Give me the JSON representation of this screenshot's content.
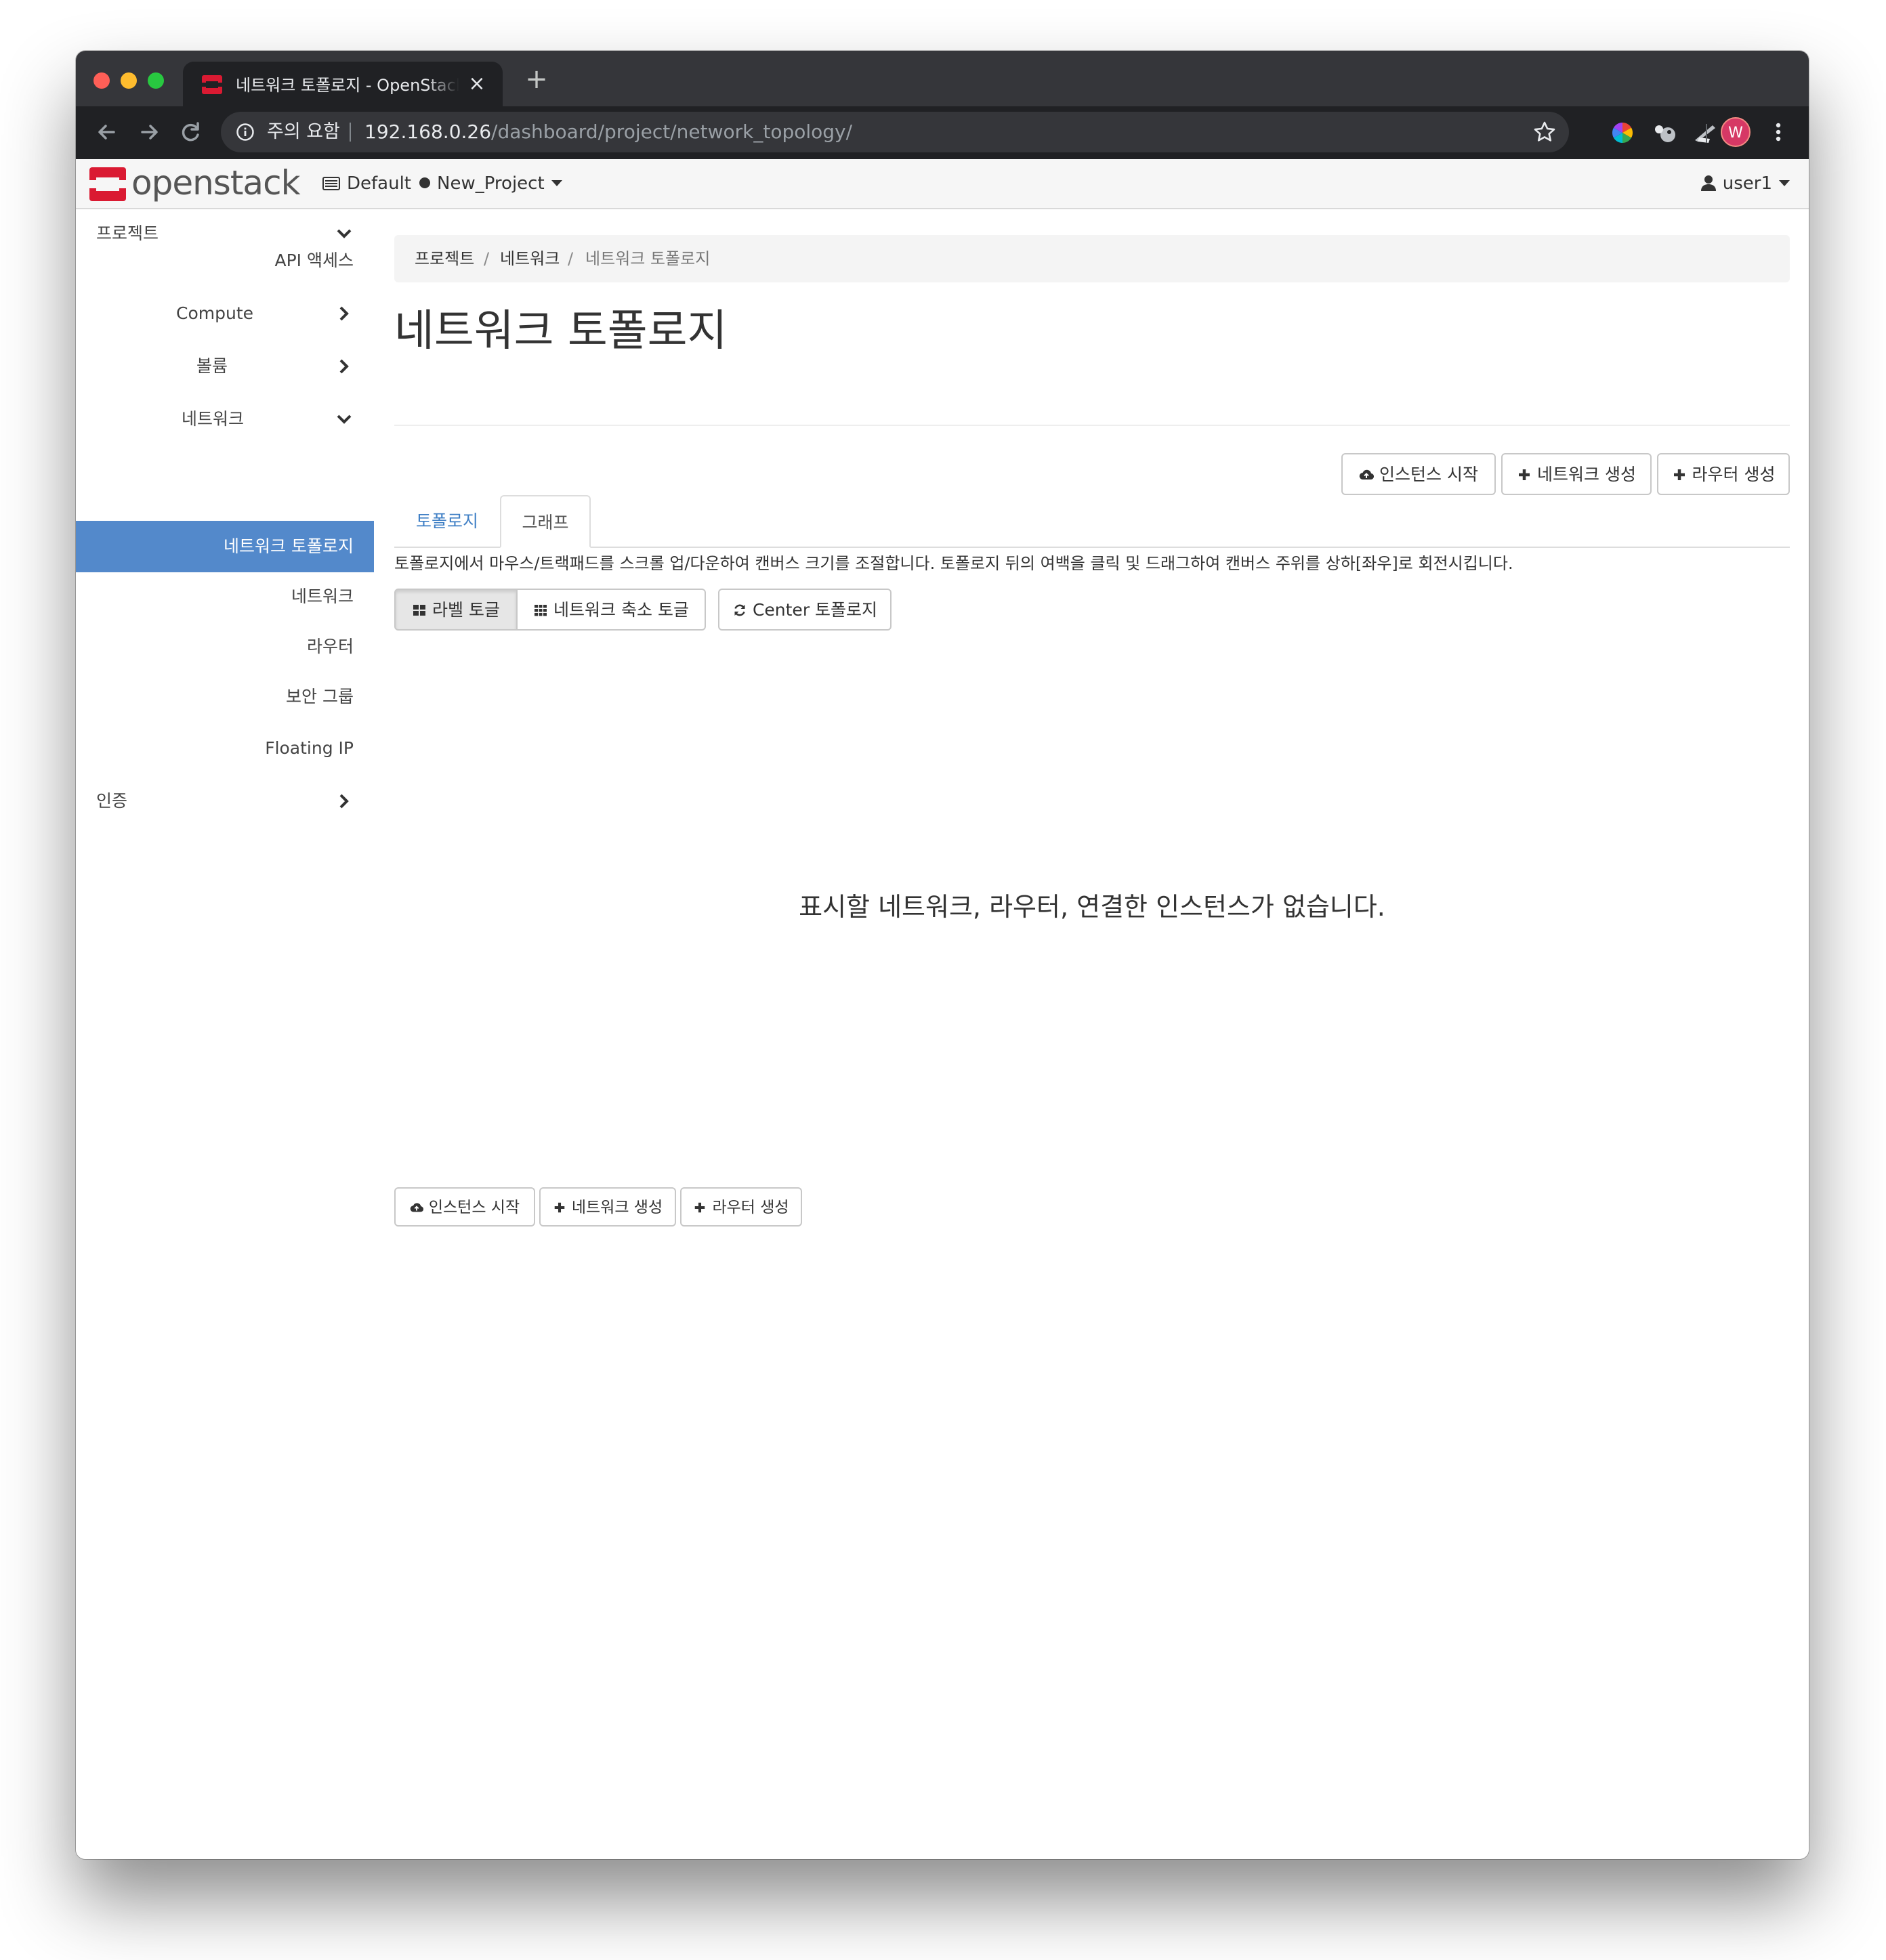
{
  "browser": {
    "tab_title": "네트워크 토폴로지 - OpenStack Dashboard",
    "new_tab_glyph": "+",
    "close_glyph": "×",
    "security_label": "주의 요함",
    "url_host": "192.168.0.26",
    "url_path": "/dashboard/project/network_topology/",
    "profile_initial": "W",
    "icons": [
      "back-arrow-icon",
      "forward-arrow-icon",
      "reload-icon",
      "info-icon",
      "star-icon",
      "color-wheel-extension-icon",
      "extension-icon",
      "extension-icon",
      "more-menu-icon"
    ]
  },
  "header": {
    "logo_text": "openstack",
    "domain": "Default",
    "project": "New_Project",
    "user": "user1",
    "brand_color": "#da1a32"
  },
  "sidebar": {
    "items": [
      {
        "label": "프로젝트",
        "chevron": "down"
      },
      {
        "label": "API 액세스"
      },
      {
        "label": "Compute",
        "chevron": "right"
      },
      {
        "label": "볼륨",
        "chevron": "right"
      },
      {
        "label": "네트워크",
        "chevron": "down"
      },
      {
        "label": "네트워크 토폴로지",
        "active": true
      },
      {
        "label": "네트워크"
      },
      {
        "label": "라우터"
      },
      {
        "label": "보안 그룹"
      },
      {
        "label": "Floating IP"
      },
      {
        "label": "인증",
        "chevron": "right"
      }
    ],
    "active_color": "#5389cb"
  },
  "breadcrumb": {
    "items": [
      "프로젝트",
      "네트워크",
      "네트워크 토폴로지"
    ],
    "separator": "/"
  },
  "main": {
    "title": "네트워크 토폴로지",
    "actions": {
      "launch_instance": "인스턴스 시작",
      "create_network": "네트워크 생성",
      "create_router": "라우터 생성"
    },
    "tabs": [
      "토폴로지",
      "그래프"
    ],
    "help_text": "토폴로지에서 마우스/트랙패드를 스크롤 업/다운하여 캔버스 크기를 조절합니다. 토폴로지 뒤의 여백을 클릭 및 드래그하여 캔버스 주위를 상하[좌우]로 회전시킵니다.",
    "toggles": {
      "labels": "라벨 토글",
      "collapse_networks": "네트워크 축소 토글",
      "center": "Center 토폴로지"
    },
    "empty_message": "표시할 네트워크, 라우터, 연결한 인스턴스가 없습니다."
  }
}
